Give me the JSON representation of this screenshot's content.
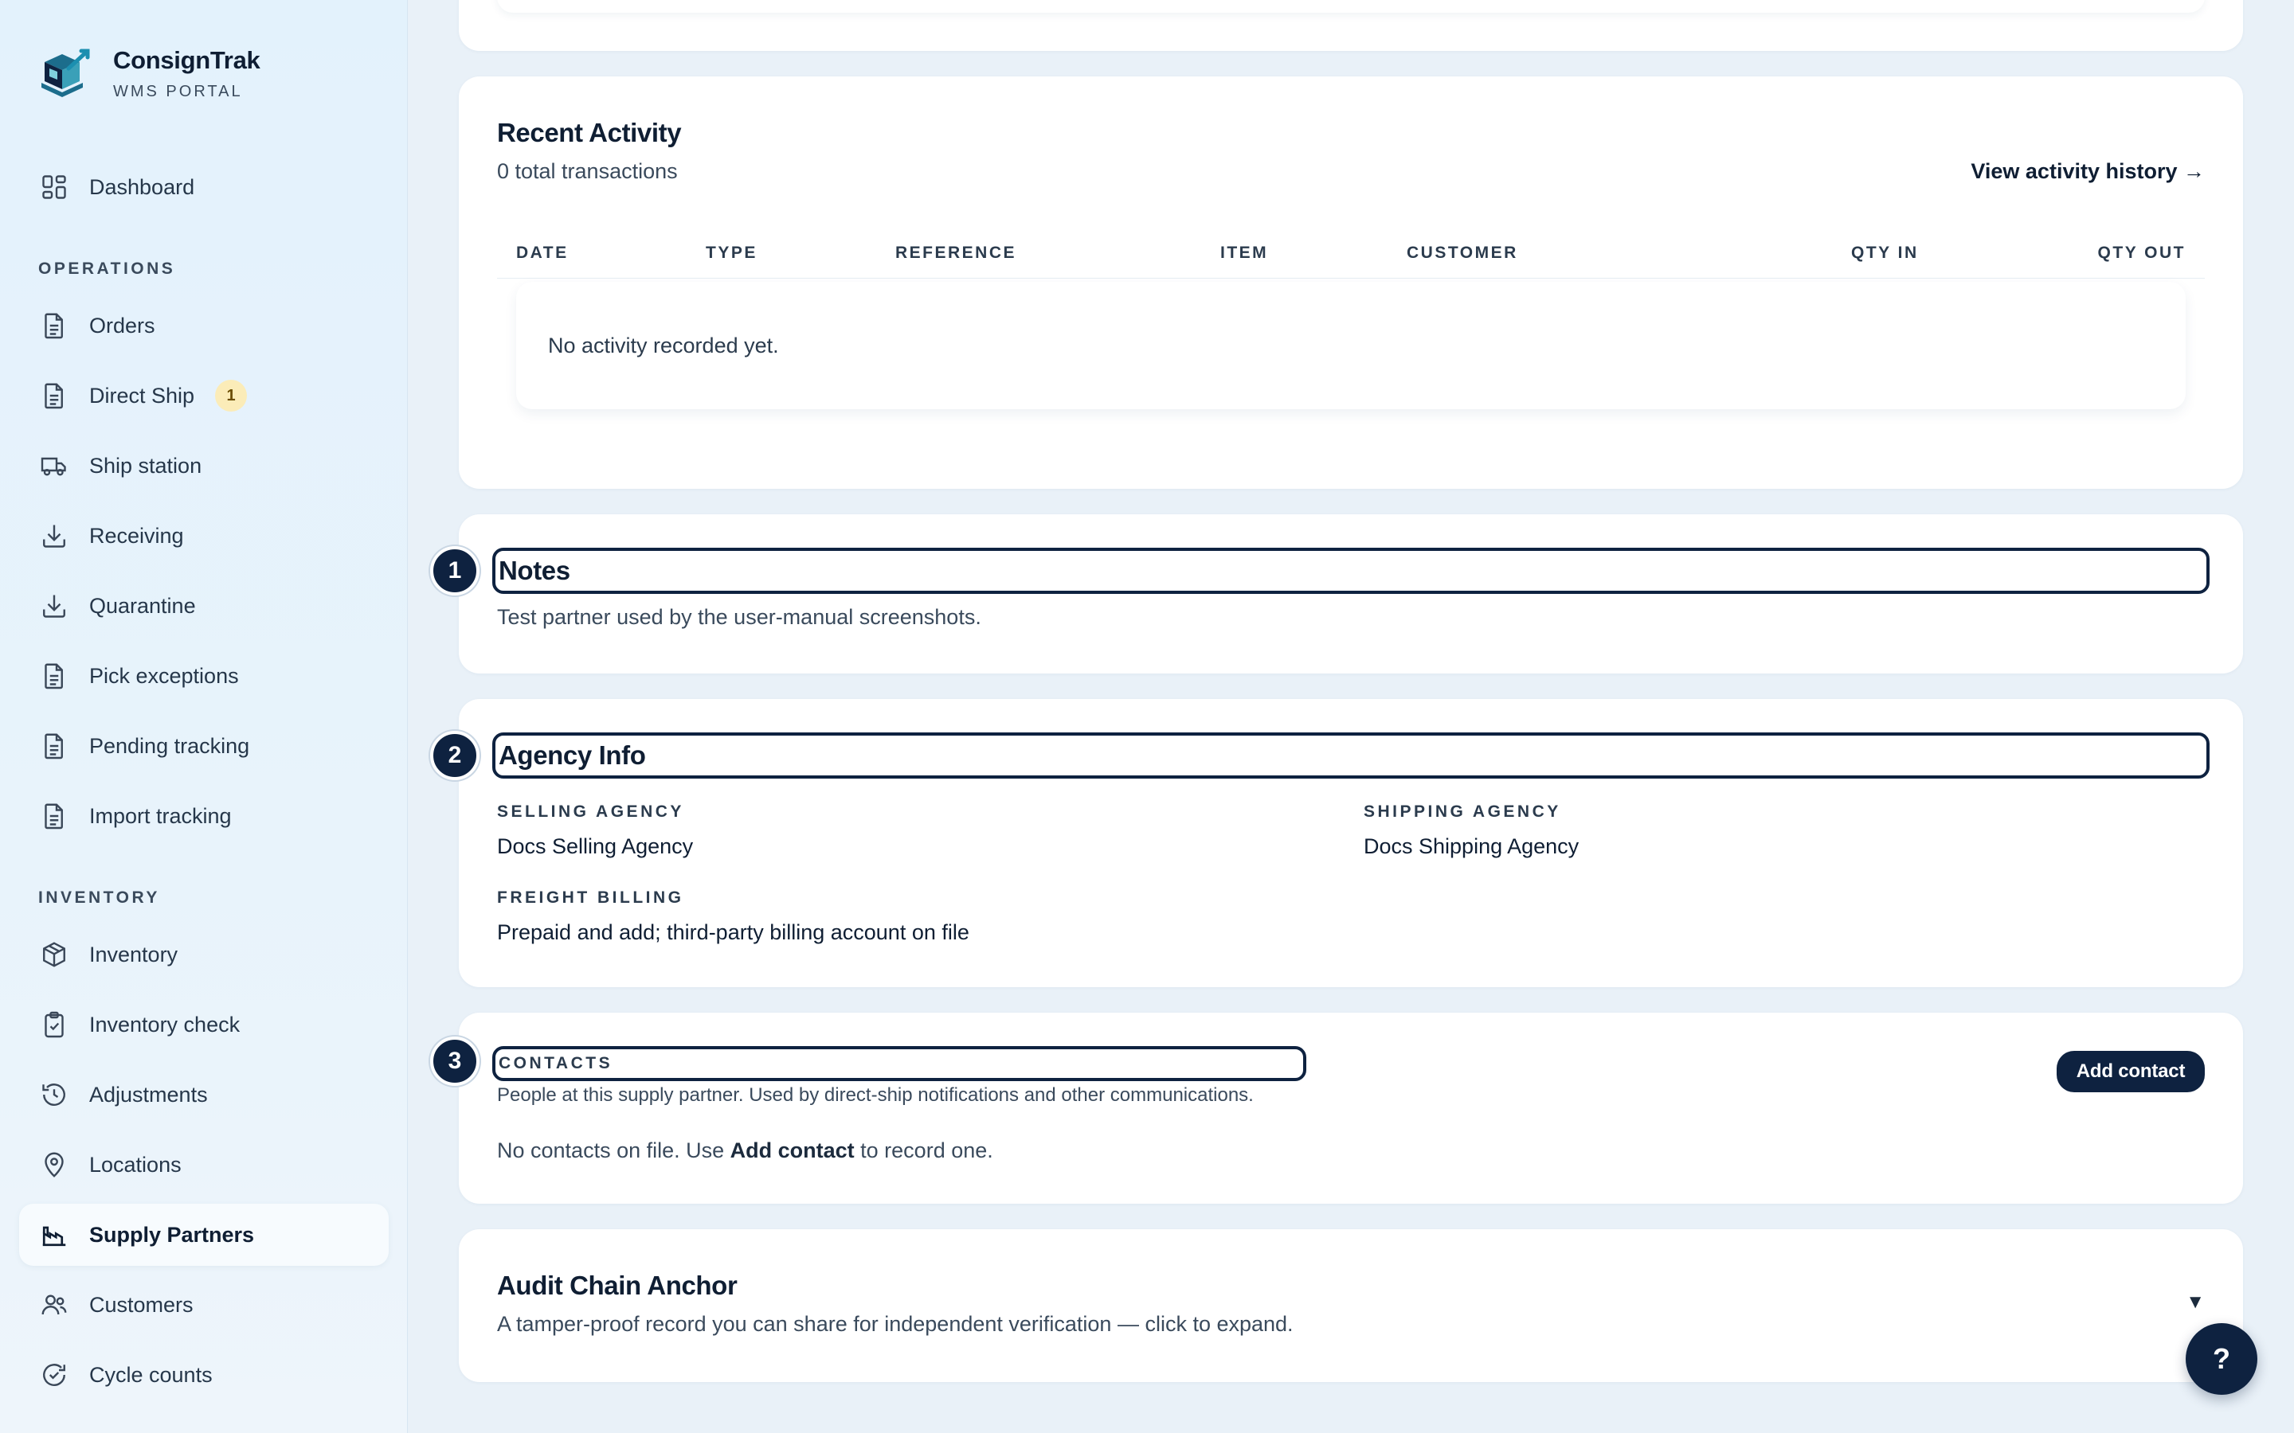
{
  "brand": {
    "name": "ConsignTrak",
    "subtitle": "WMS PORTAL"
  },
  "sidebar": {
    "dashboard": "Dashboard",
    "sections": {
      "operations": "OPERATIONS",
      "inventory": "INVENTORY"
    },
    "operations": [
      {
        "label": "Orders",
        "icon": "document-icon"
      },
      {
        "label": "Direct Ship",
        "icon": "document-icon",
        "badge": "1"
      },
      {
        "label": "Ship station",
        "icon": "truck-icon"
      },
      {
        "label": "Receiving",
        "icon": "download-icon"
      },
      {
        "label": "Quarantine",
        "icon": "download-icon"
      },
      {
        "label": "Pick exceptions",
        "icon": "document-icon"
      },
      {
        "label": "Pending tracking",
        "icon": "document-icon"
      },
      {
        "label": "Import tracking",
        "icon": "document-icon"
      }
    ],
    "inventory": [
      {
        "label": "Inventory",
        "icon": "box-icon"
      },
      {
        "label": "Inventory check",
        "icon": "clipboard-check-icon"
      },
      {
        "label": "Adjustments",
        "icon": "history-icon"
      },
      {
        "label": "Locations",
        "icon": "map-pin-icon"
      },
      {
        "label": "Supply Partners",
        "icon": "factory-icon",
        "active": true
      },
      {
        "label": "Customers",
        "icon": "users-icon"
      },
      {
        "label": "Cycle counts",
        "icon": "refresh-check-icon"
      }
    ]
  },
  "recent_activity": {
    "title": "Recent Activity",
    "subtitle": "0 total transactions",
    "history_link": "View activity history →",
    "columns": [
      "DATE",
      "TYPE",
      "REFERENCE",
      "ITEM",
      "CUSTOMER",
      "QTY IN",
      "QTY OUT"
    ],
    "empty_text": "No activity recorded yet."
  },
  "notes": {
    "step": "1",
    "title": "Notes",
    "text": "Test partner used by the user-manual screenshots."
  },
  "agency": {
    "step": "2",
    "title": "Agency Info",
    "selling_label": "SELLING AGENCY",
    "selling_value": "Docs Selling Agency",
    "shipping_label": "SHIPPING AGENCY",
    "shipping_value": "Docs Shipping Agency",
    "freight_label": "FREIGHT BILLING",
    "freight_value": "Prepaid and add; third-party billing account on file"
  },
  "contacts": {
    "step": "3",
    "title": "CONTACTS",
    "description": "People at this supply partner. Used by direct-ship notifications and other communications.",
    "empty_prefix": "No contacts on file. Use ",
    "empty_strong": "Add contact",
    "empty_suffix": " to record one.",
    "add_button": "Add contact"
  },
  "audit": {
    "title": "Audit Chain Anchor",
    "description": "A tamper-proof record you can share for independent verification — click to expand.",
    "toggle": "▼"
  },
  "help": {
    "label": "?"
  },
  "colors": {
    "navy": "#0e2240",
    "badge_bg": "#fbecb8",
    "page_bg": "#e9f1f8"
  }
}
